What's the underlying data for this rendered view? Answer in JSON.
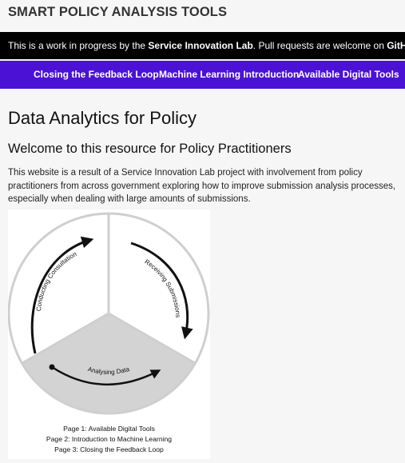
{
  "site": {
    "title": "SMART POLICY ANALYSIS TOOLS"
  },
  "banner": {
    "text_before": "This is a work in progress by the ",
    "lab_link": "Service Innovation Lab",
    "text_middle": ". Pull requests are welcome on ",
    "github_link": "GitHub",
    "text_after": "."
  },
  "nav": {
    "items": [
      {
        "label": "Closing the Feedback Loop"
      },
      {
        "label": "Machine Learning Introduction"
      },
      {
        "label": "Available Digital Tools"
      }
    ]
  },
  "main": {
    "title": "Data Analytics for Policy",
    "subtitle": "Welcome to this resource for Policy Practitioners",
    "intro": "This website is a result of a Service Innovation Lab project with involvement from policy practitioners from across government exploring how to improve submission analysis processes, especially when dealing with large amounts of submissions."
  },
  "diagram": {
    "segments": [
      "Conducting Consultation",
      "Receiving Submissions",
      "Analysing Data"
    ],
    "captions": [
      "Page 1: Available Digital Tools",
      "Page 2: Introduction to Machine Learning",
      "Page 3: Closing the Feedback Loop"
    ],
    "colors": {
      "circle_stroke": "#cfcfcf",
      "bottom_sector": "#d3d3d3",
      "arrows": "#111111"
    }
  }
}
